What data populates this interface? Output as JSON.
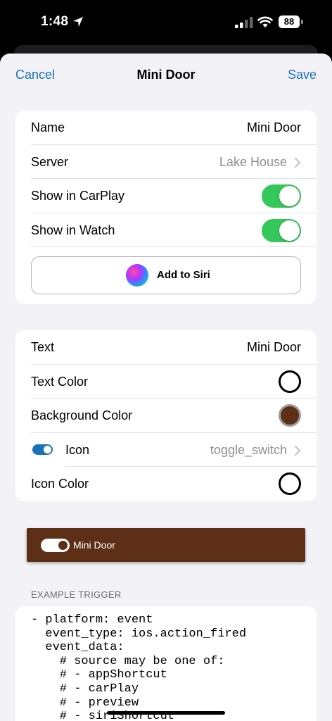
{
  "status_bar": {
    "time": "1:48",
    "battery": "88",
    "location_icon": "location-arrow-icon",
    "signal_icon": "cellular-signal-icon",
    "wifi_icon": "wifi-icon"
  },
  "nav": {
    "cancel": "Cancel",
    "title": "Mini Door",
    "save": "Save"
  },
  "general": {
    "name_label": "Name",
    "name_value": "Mini Door",
    "server_label": "Server",
    "server_value": "Lake House",
    "carplay_label": "Show in CarPlay",
    "carplay_on": true,
    "watch_label": "Show in Watch",
    "watch_on": true,
    "siri_button": "Add to Siri"
  },
  "appearance": {
    "text_label": "Text",
    "text_value": "Mini Door",
    "text_color_label": "Text Color",
    "text_color": "#ffffff",
    "background_color_label": "Background Color",
    "background_color": "#5d2f16",
    "icon_label": "Icon",
    "icon_value": "toggle_switch",
    "icon_color_label": "Icon Color",
    "icon_color": "#ffffff"
  },
  "preview": {
    "label": "Mini Door"
  },
  "example_trigger": {
    "header": "EXAMPLE TRIGGER",
    "code": "- platform: event\n  event_type: ios.action_fired\n  event_data:\n    # source may be one of:\n    # - appShortcut\n    # - carPlay\n    # - preview\n    # - siriShortcut"
  },
  "colors": {
    "accent": "#1a73b8",
    "switch_on": "#34c759",
    "sheet_background": "#f2f2f7"
  }
}
